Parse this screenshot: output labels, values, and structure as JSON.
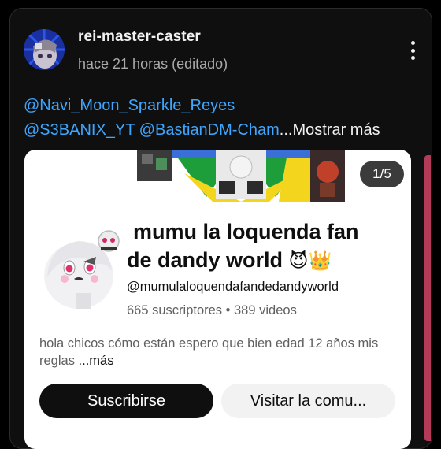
{
  "post": {
    "author": "rei-master-caster",
    "time": "hace 21 horas (editado)",
    "mentions": {
      "line1": "@Navi_Moon_Sparkle_Reyes",
      "mention2": "@S3BANIX_YT",
      "mention3": "@BastianDM-Cham",
      "ellipsis": "...",
      "show_more": "Mostrar más"
    }
  },
  "embed": {
    "counter": "1/5",
    "channel": {
      "name_line1": "mumu la loquenda fan",
      "name_line2": "de dandy world",
      "name_emojis": "😈👑",
      "handle": "@mumulaloquendafandedandyworld",
      "stats": "665 suscriptores • 389 videos",
      "description": "hola chicos cómo están espero que bien edad 12 años mis reglas ",
      "description_more": "...más"
    },
    "subscribe_label": "Suscribirse",
    "visit_label": "Visitar la comu..."
  },
  "colors": {
    "background": "#000000",
    "card": "#0f0f0f",
    "link": "#3ea6ff",
    "embed_bg": "#ffffff",
    "subscribe_bg": "#0f0f0f",
    "visit_bg": "#f2f2f2",
    "next_card_edge": "#b43a5a"
  },
  "icons": {
    "post_menu": "more-vert-icon"
  }
}
